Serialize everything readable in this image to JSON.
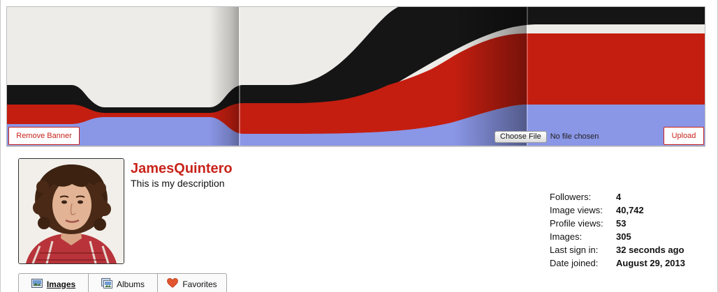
{
  "banner": {
    "remove_label": "Remove Banner",
    "choose_file_label": "Choose File",
    "no_file_text": "No file chosen",
    "upload_label": "Upload",
    "colors": {
      "background": "#eeece8",
      "black_stripe": "#151515",
      "red_stripe": "#c41e10",
      "blue_stripe": "#8a96e6"
    }
  },
  "profile": {
    "username": "JamesQuintero",
    "description": "This is my description",
    "avatar_icon": "user-avatar-photo"
  },
  "stats": [
    {
      "label": "Followers:",
      "value": "4"
    },
    {
      "label": "Image views:",
      "value": "40,742"
    },
    {
      "label": "Profile views:",
      "value": "53"
    },
    {
      "label": "Images:",
      "value": "305"
    },
    {
      "label": "Last sign in:",
      "value": "32 seconds ago"
    },
    {
      "label": "Date joined:",
      "value": "August 29, 2013"
    }
  ],
  "tabs": [
    {
      "label": "Images",
      "icon": "images-icon",
      "active": true
    },
    {
      "label": "Albums",
      "icon": "albums-icon",
      "active": false
    },
    {
      "label": "Favorites",
      "icon": "heart-icon",
      "active": false
    }
  ],
  "accent_color": "#c8241b"
}
